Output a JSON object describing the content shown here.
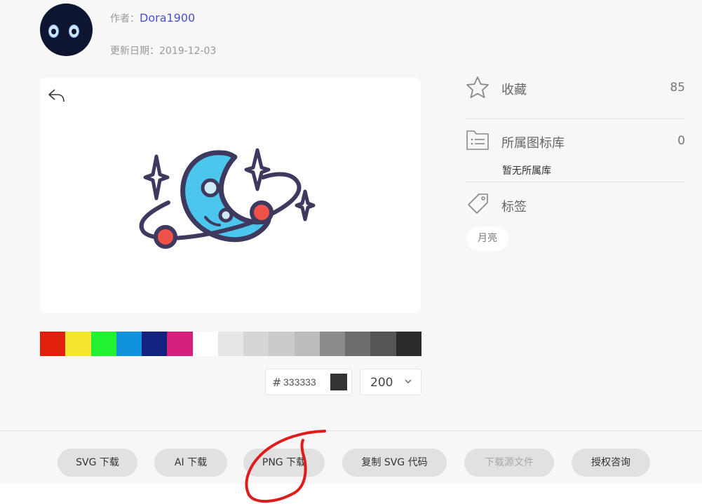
{
  "author": {
    "label": "作者：",
    "name": "Dora1900"
  },
  "update": {
    "label": "更新日期：",
    "date": "2019-12-03"
  },
  "icons": {
    "undo": "undo-arrow-icon",
    "star": "star-icon",
    "library": "folder-list-icon",
    "tag": "tag-icon",
    "chevron": "chevron-down-icon",
    "artwork": "moon-planet-sparkles"
  },
  "palette": [
    "#e0200b",
    "#f5e72f",
    "#22f131",
    "#1093dc",
    "#13227f",
    "#d4207a",
    "#ffffff",
    "#e6e6e6",
    "#d6d6d6",
    "#cacaca",
    "#bcbcbc",
    "#8b8b8b",
    "#6d6d6d",
    "#555555",
    "#2a2a2a"
  ],
  "color_input": {
    "hash": "#",
    "value": "333333",
    "chip_color": "#333333"
  },
  "size_select": {
    "value": "200"
  },
  "sidebar": {
    "favorites": {
      "label": "收藏",
      "count": "85"
    },
    "library": {
      "label": "所属图标库",
      "count": "0",
      "empty_text": "暂无所属库"
    },
    "tags": {
      "label": "标签",
      "items": [
        "月亮"
      ]
    }
  },
  "actions": {
    "svg_download": "SVG 下载",
    "ai_download": "AI 下载",
    "png_download": "PNG 下载",
    "copy_svg": "复制 SVG 代码",
    "source_download": "下载源文件",
    "license": "授权咨询"
  },
  "colors": {
    "accent": "#4a4ed8",
    "annotation": "#e01b1b"
  }
}
